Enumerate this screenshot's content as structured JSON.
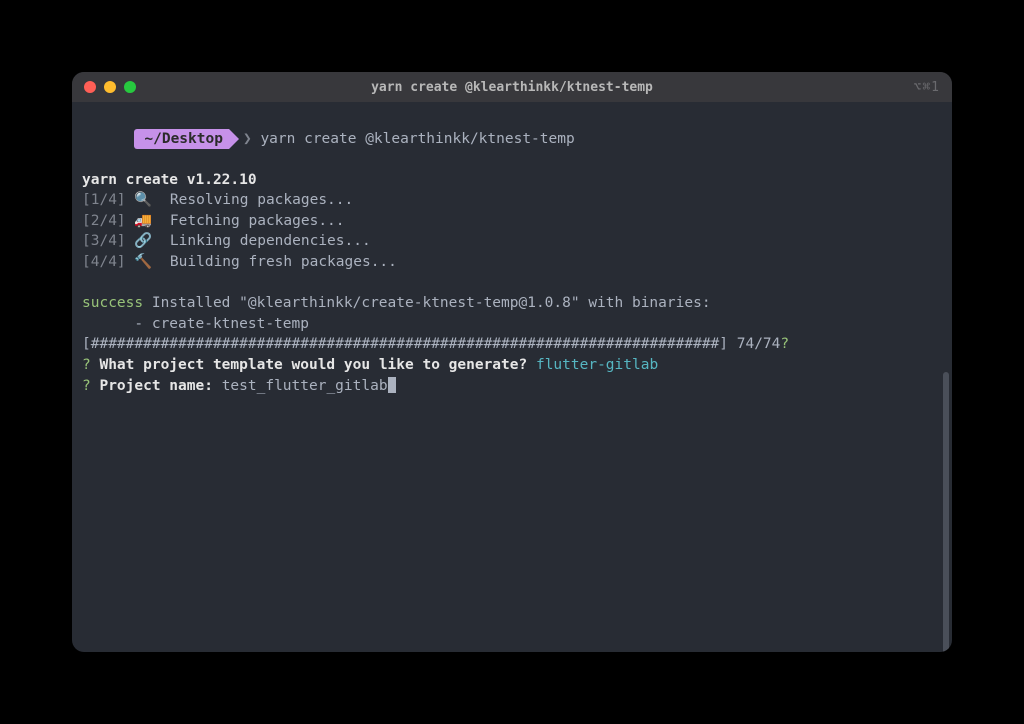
{
  "titlebar": {
    "title": "yarn create @klearthinkk/ktnest-temp",
    "shortcut": "⌥⌘1"
  },
  "prompt": {
    "cwd": "~/Desktop",
    "symbol": "❯",
    "command": "yarn create @klearthinkk/ktnest-temp"
  },
  "output": {
    "version_line": "yarn create v1.22.10",
    "steps": [
      {
        "num": "[1/4]",
        "icon": "🔍",
        "text": "Resolving packages..."
      },
      {
        "num": "[2/4]",
        "icon": "🚚",
        "text": "Fetching packages..."
      },
      {
        "num": "[3/4]",
        "icon": "🔗",
        "text": "Linking dependencies..."
      },
      {
        "num": "[4/4]",
        "icon": "🔨",
        "text": "Building fresh packages..."
      }
    ],
    "success_label": "success",
    "success_text": " Installed \"@klearthinkk/create-ktnest-temp@1.0.8\" with binaries:",
    "binary_line": "      - create-ktnest-temp",
    "progress": {
      "open": "[",
      "fill": "########################################################################",
      "close": "]",
      "count": " 74/74",
      "q": "?"
    },
    "q1": {
      "mark": "?",
      "question": " What project template would you like to generate?",
      "answer": " flutter-gitlab"
    },
    "q2": {
      "mark": "?",
      "label": " Project name: ",
      "input": "test_flutter_gitlab"
    }
  }
}
